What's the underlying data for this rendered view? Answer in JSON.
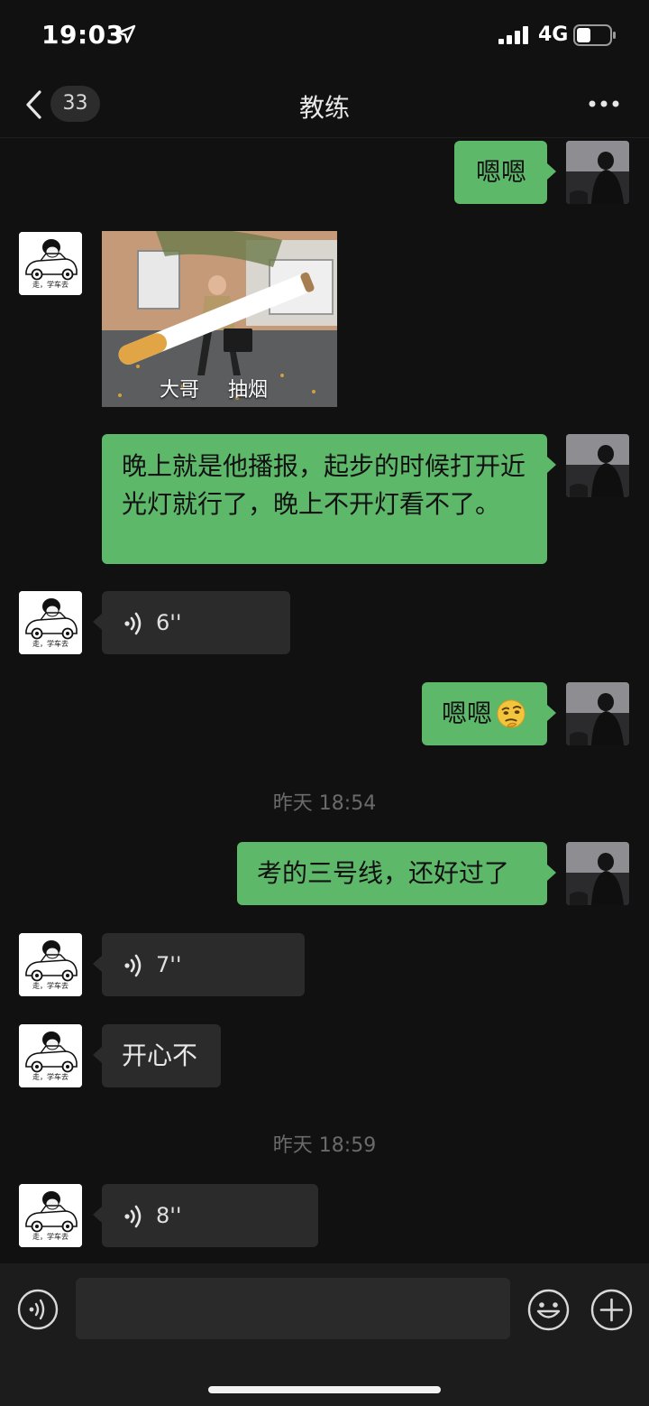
{
  "status_bar": {
    "time": "19:03",
    "network": "4G"
  },
  "nav": {
    "unread_count": "33",
    "title": "教练"
  },
  "messages": [
    {
      "from": "me",
      "type": "text",
      "text": "嗯嗯"
    },
    {
      "from": "coach",
      "type": "image",
      "caption_left": "大哥",
      "caption_right": "抽烟"
    },
    {
      "from": "me",
      "type": "text",
      "text": "晚上就是他播报，起步的时候打开近光灯就行了，晚上不开灯看不了。"
    },
    {
      "from": "coach",
      "type": "voice",
      "duration": "6''"
    },
    {
      "from": "me",
      "type": "text",
      "text": "嗯嗯",
      "emoji": "thinking-face"
    },
    {
      "type": "timestamp",
      "text": "昨天 18:54"
    },
    {
      "from": "me",
      "type": "text",
      "text": "考的三号线，还好过了"
    },
    {
      "from": "coach",
      "type": "voice",
      "duration": "7''"
    },
    {
      "from": "coach",
      "type": "text",
      "text": "开心不"
    },
    {
      "type": "timestamp",
      "text": "昨天 18:59"
    },
    {
      "from": "coach",
      "type": "voice",
      "duration": "8''"
    }
  ],
  "coach_avatar": {
    "caption": "走，学车去"
  },
  "input": {
    "placeholder": ""
  },
  "colors": {
    "background": "#111111",
    "my_bubble": "#5db86a",
    "their_bubble": "#2b2b2b",
    "input_bar": "#1c1c1c"
  },
  "icons": [
    "location-arrow-icon",
    "signal-icon",
    "battery-icon",
    "back-chevron-icon",
    "more-icon",
    "voice-wave-icon",
    "voice-input-icon",
    "emoji-icon",
    "plus-icon"
  ]
}
